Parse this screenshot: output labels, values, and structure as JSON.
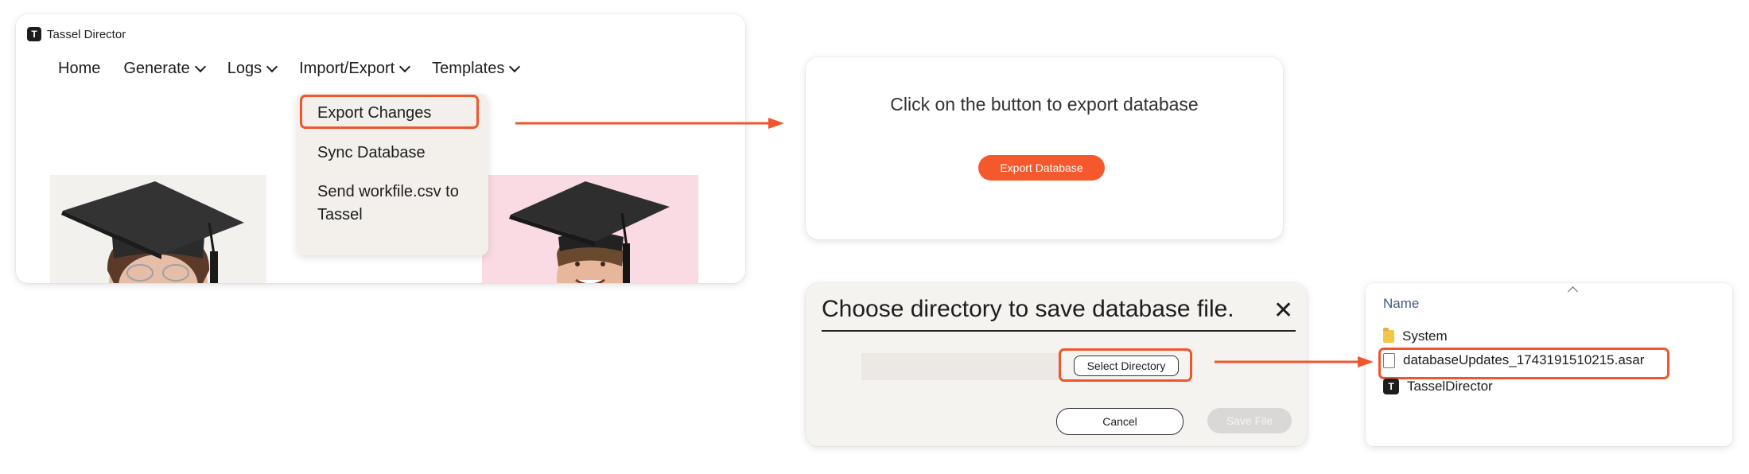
{
  "app": {
    "title": "Tassel Director",
    "logo_glyph": "T",
    "nav": [
      {
        "label": "Home",
        "dropdown": false
      },
      {
        "label": "Generate",
        "dropdown": true
      },
      {
        "label": "Logs",
        "dropdown": true
      },
      {
        "label": "Import/Export",
        "dropdown": true
      },
      {
        "label": "Templates",
        "dropdown": true
      }
    ],
    "import_export_menu": [
      {
        "label": "Export Changes",
        "highlighted": true
      },
      {
        "label": "Sync Database",
        "highlighted": false
      },
      {
        "label": "Send workfile.csv to Tassel",
        "highlighted": false
      }
    ]
  },
  "export_panel": {
    "heading": "Click on the button to export database",
    "button_label": "Export Database"
  },
  "directory_dialog": {
    "title": "Choose directory to save database file.",
    "close_glyph": "✕",
    "select_label": "Select Directory",
    "cancel_label": "Cancel",
    "save_label": "Save File"
  },
  "explorer": {
    "column_header": "Name",
    "items": [
      {
        "name": "System",
        "type": "folder"
      },
      {
        "name": "databaseUpdates_1743191510215.asar",
        "type": "file",
        "highlighted": true
      },
      {
        "name": "TasselDirector",
        "type": "app"
      }
    ]
  },
  "colors": {
    "accent": "#f5582c",
    "highlight_border": "#f0552e",
    "menu_bg": "#f3f0eb",
    "dialog_bg": "#f5f3ef"
  }
}
